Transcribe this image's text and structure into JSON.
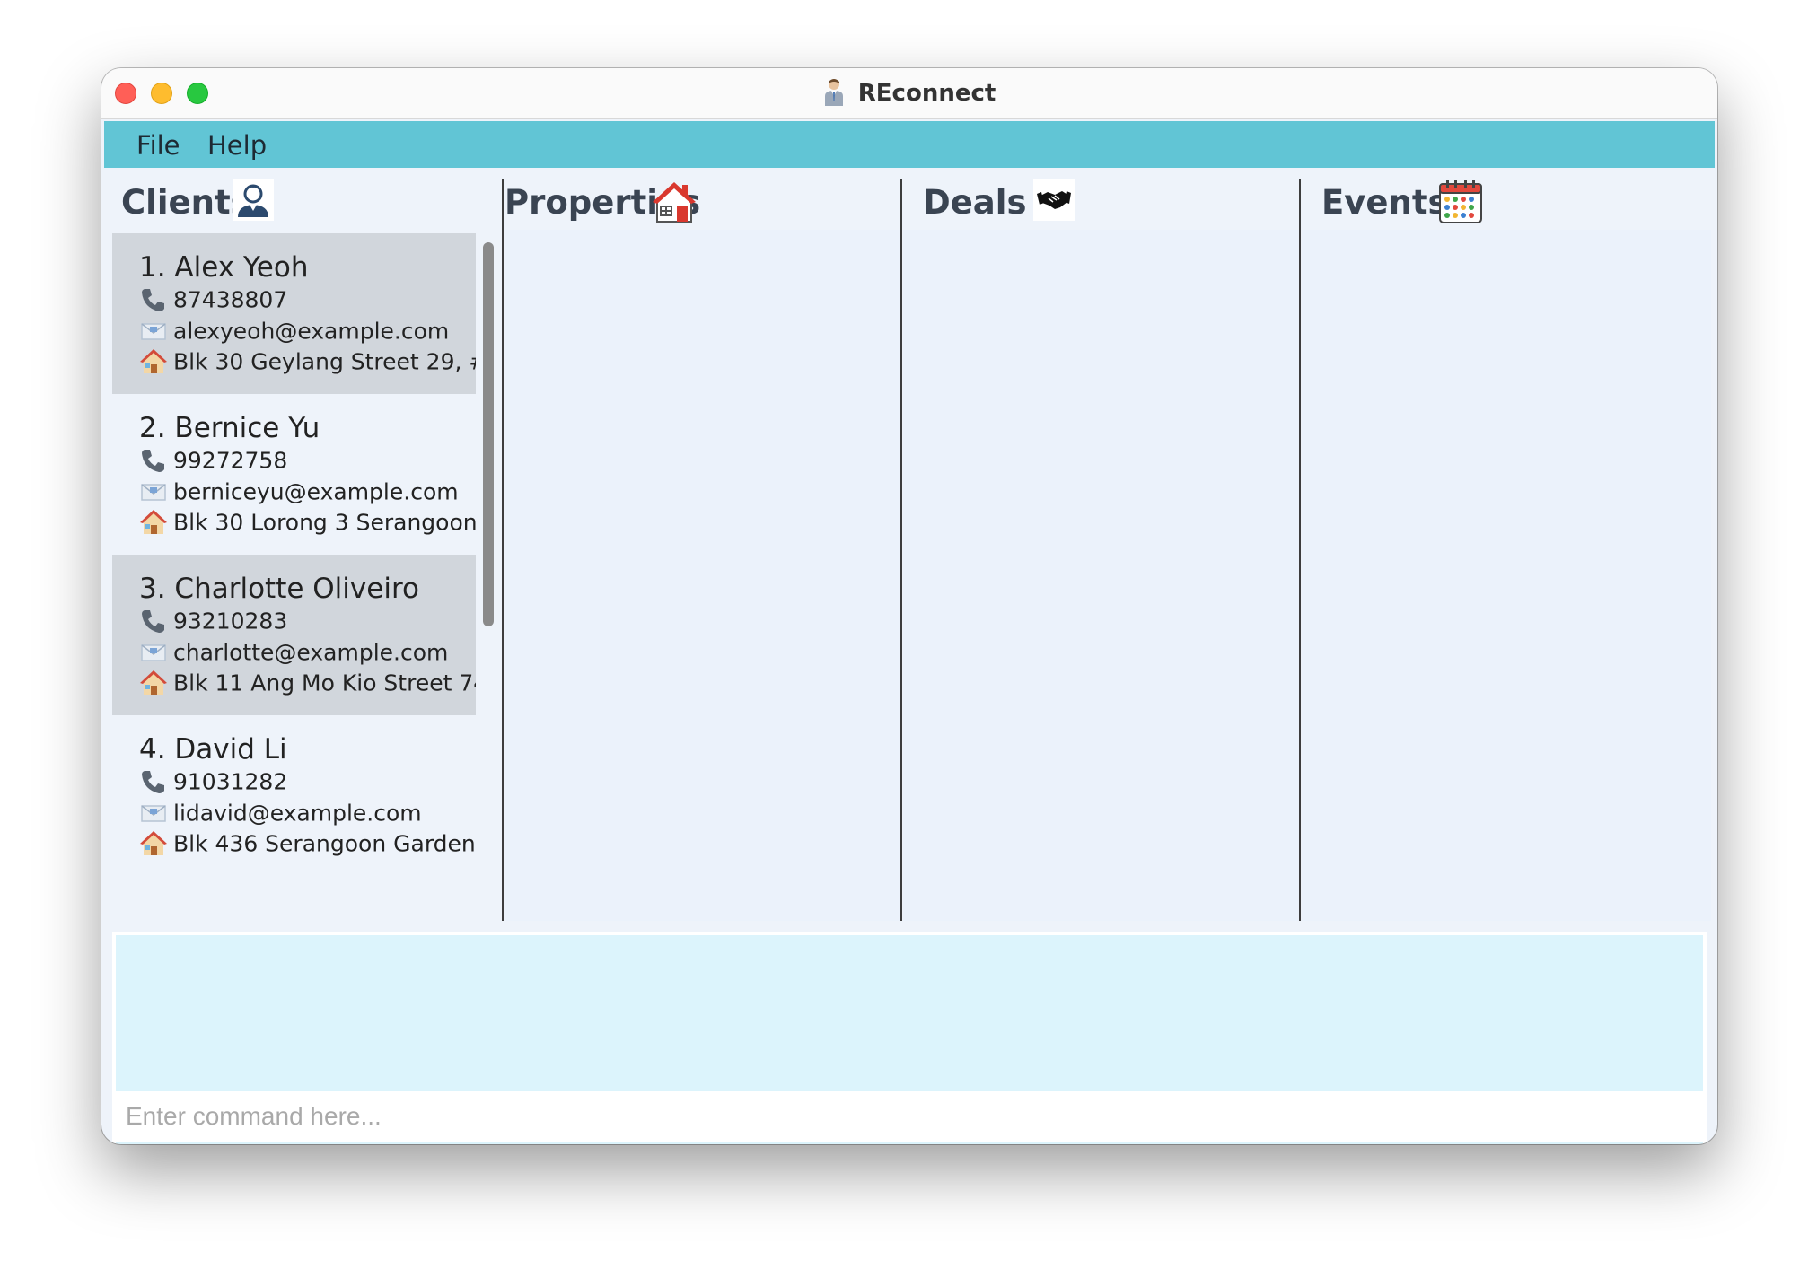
{
  "window": {
    "title": "REconnect",
    "title_icon": "businessman-icon"
  },
  "menu": {
    "items": [
      "File",
      "Help"
    ]
  },
  "panels": {
    "clients": {
      "title": "Clients",
      "icon": "person-icon"
    },
    "properties": {
      "title": "Properties",
      "icon": "house-icon"
    },
    "deals": {
      "title": "Deals",
      "icon": "handshake-icon"
    },
    "events": {
      "title": "Events",
      "icon": "calendar-icon"
    }
  },
  "clients": [
    {
      "name": "1. Alex Yeoh",
      "phone": "87438807",
      "email": "alexyeoh@example.com",
      "address": "Blk 30 Geylang Street 29, #..."
    },
    {
      "name": "2. Bernice Yu",
      "phone": "99272758",
      "email": "berniceyu@example.com",
      "address": "Blk 30 Lorong 3 Serangoon ..."
    },
    {
      "name": "3. Charlotte Oliveiro",
      "phone": "93210283",
      "email": "charlotte@example.com",
      "address": "Blk 11 Ang Mo Kio Street 74..."
    },
    {
      "name": "4. David Li",
      "phone": "91031282",
      "email": "lidavid@example.com",
      "address": "Blk 436 Serangoon Garden"
    }
  ],
  "result": {
    "text": ""
  },
  "command": {
    "placeholder": "Enter command here...",
    "value": ""
  },
  "colors": {
    "menubar": "#61c5d5",
    "result_bg": "#dcf4fc",
    "selected_card": "#d1d6dc"
  }
}
